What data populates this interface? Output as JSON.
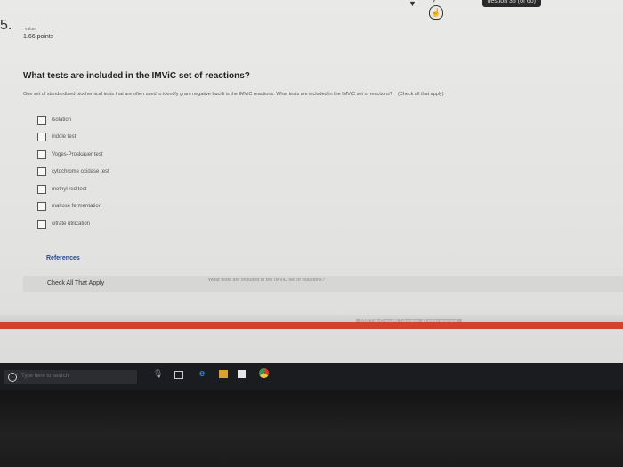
{
  "header": {
    "question_counter": "uestion 35 (of 60)",
    "nav_down_icon": "chevron-down-icon",
    "nav_right_icon": "chevron-right-icon",
    "cursor_icon": "hand-pointer-icon"
  },
  "question": {
    "number": "5.",
    "value_label": "value:",
    "points": "1.66 points",
    "title": "What tests are included in the IMViC set of reactions?",
    "prompt": "One set of standardized biochemical tests that are often used to identify gram negative bacilli is the IMViC reactions. What tests are included in the IMViC set of reactions?",
    "instruction": "(Check all that apply)",
    "options": [
      {
        "label": "isolation",
        "checked": false
      },
      {
        "label": "indole test",
        "checked": false
      },
      {
        "label": "Voges-Proskauer test",
        "checked": false
      },
      {
        "label": "cytochrome oxidase test",
        "checked": false
      },
      {
        "label": "methyl red test",
        "checked": false
      },
      {
        "label": "maltose fermentation",
        "checked": false
      },
      {
        "label": "citrate utilization",
        "checked": false
      }
    ]
  },
  "references_label": "References",
  "footer_bar": {
    "label": "Check All That Apply",
    "question_repeat": "What tests are included in the IMViC set of reactions?"
  },
  "copyright": "©2017 McGraw-Hill Education. All rights reserved.",
  "taskbar": {
    "search_placeholder": "Type here to search",
    "icons": [
      "cortana-icon",
      "microphone-icon",
      "task-view-icon",
      "edge-icon",
      "file-explorer-icon",
      "store-icon",
      "chrome-icon"
    ]
  },
  "colors": {
    "accent_red": "#d2422e",
    "link_blue": "#2a4a8a",
    "taskbar": "#1b1c1f"
  }
}
